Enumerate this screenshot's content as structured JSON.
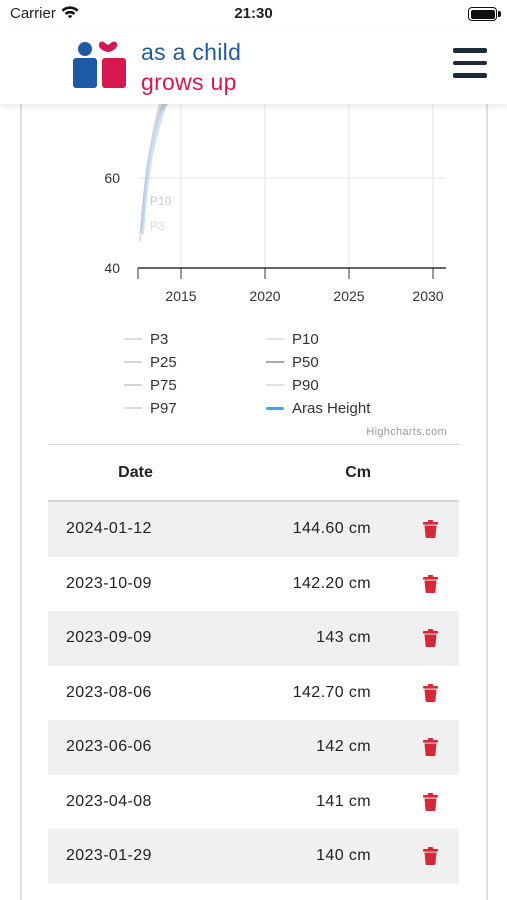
{
  "status_bar": {
    "carrier": "Carrier",
    "time": "21:30"
  },
  "header": {
    "logo_line1": "as a child",
    "logo_line2": "grows up",
    "menu_icon": "hamburger-menu-icon"
  },
  "colors": {
    "brand_blue": "#1c5aa6",
    "brand_pink": "#d6184f",
    "delete_red": "#d62839",
    "series_blue": "#4a9ff0"
  },
  "chart_data": {
    "type": "line",
    "x_ticks": [
      "2015",
      "2020",
      "2025",
      "2030"
    ],
    "y_ticks": [
      "40",
      "60"
    ],
    "visible_annotations": [
      "P10",
      "P3"
    ],
    "series": [
      {
        "name": "P3"
      },
      {
        "name": "P10"
      },
      {
        "name": "P25"
      },
      {
        "name": "P50"
      },
      {
        "name": "P75"
      },
      {
        "name": "P90"
      },
      {
        "name": "P97"
      },
      {
        "name": "Aras Height"
      }
    ],
    "credits": "Highcharts.com"
  },
  "legend_icons": [
    "legend-line-icon"
  ],
  "table": {
    "headers": {
      "date": "Date",
      "cm": "Cm"
    },
    "rows": [
      {
        "date": "2024-01-12",
        "cm": "144.60 cm"
      },
      {
        "date": "2023-10-09",
        "cm": "142.20 cm"
      },
      {
        "date": "2023-09-09",
        "cm": "143 cm"
      },
      {
        "date": "2023-08-06",
        "cm": "142.70 cm"
      },
      {
        "date": "2023-06-06",
        "cm": "142 cm"
      },
      {
        "date": "2023-04-08",
        "cm": "141 cm"
      },
      {
        "date": "2023-01-29",
        "cm": "140 cm"
      }
    ],
    "row_icon": "trash-icon"
  }
}
